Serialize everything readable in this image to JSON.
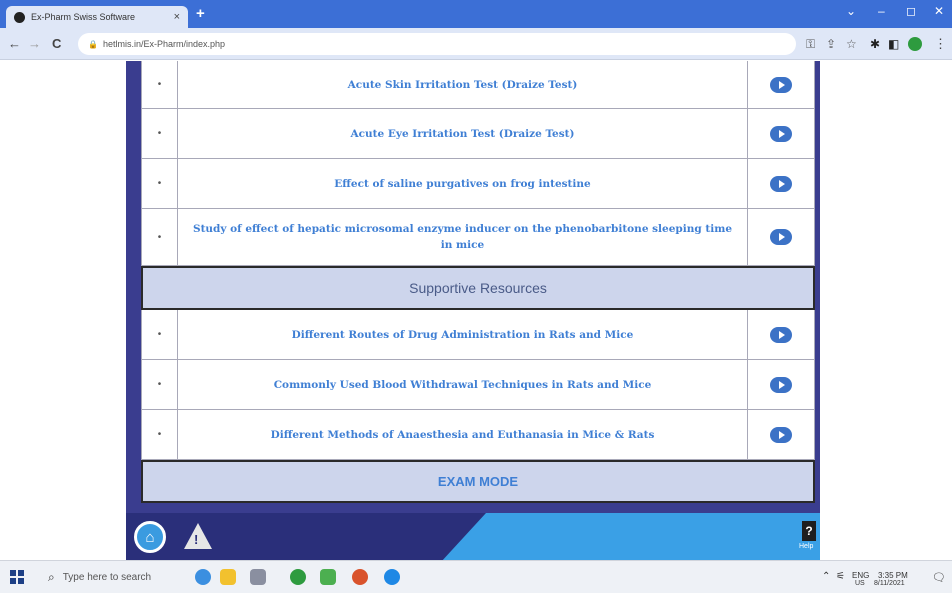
{
  "browser": {
    "tab_title": "Ex-Pharm Swiss Software",
    "tab_close": "×",
    "new_tab": "+",
    "url": "hetlmis.in/Ex-Pharm/index.php",
    "window_controls": [
      "⌄",
      "–",
      "◻",
      "✕"
    ]
  },
  "nav": {
    "back": "←",
    "forward": "→",
    "reload": "C",
    "menu": "⋮"
  },
  "rows_top": [
    {
      "num": "•",
      "title": "Acute Skin Irritation Test (Draize Test)"
    },
    {
      "num": "•",
      "title": "Acute Eye Irritation Test (Draize Test)"
    },
    {
      "num": "•",
      "title": "Effect of saline purgatives on frog intestine"
    },
    {
      "num": "•",
      "title": "Study of effect of hepatic microsomal enzyme inducer on the phenobarbitone sleeping time in mice"
    }
  ],
  "section_heading": "Supportive Resources",
  "rows_supportive": [
    {
      "num": "•",
      "title": "Different Routes of Drug Administration in Rats and Mice"
    },
    {
      "num": "•",
      "title": "Commonly Used Blood Withdrawal Techniques in Rats and Mice"
    },
    {
      "num": "•",
      "title": "Different Methods of Anaesthesia and Euthanasia in Mice & Rats"
    }
  ],
  "exam_mode": "EXAM MODE",
  "bottom": {
    "home_glyph": "⌂",
    "warn_glyph": "!",
    "help_glyph": "?",
    "help_label": "Help"
  },
  "taskbar": {
    "search_placeholder": "Type here to search",
    "tray_lang": "ENG",
    "tray_region": "US",
    "clock_time": "3:35 PM",
    "clock_date": "8/11/2021"
  },
  "colors": {
    "accent_blue": "#3f7fd4",
    "panel_navy": "#3a3d8f",
    "bar_sky": "#3aa0e6"
  }
}
